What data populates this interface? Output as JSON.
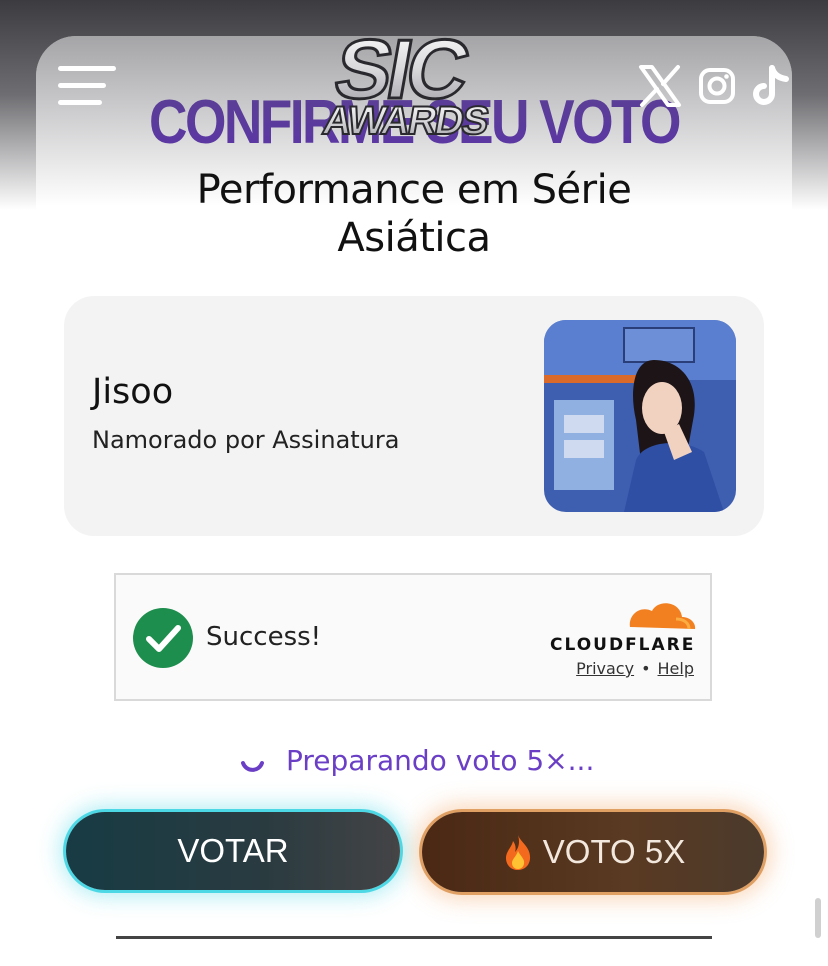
{
  "header": {
    "logo_text": "SIC AWARDS",
    "confirm_heading": "CONFIRME SEU VOTO",
    "menu_icon": "hamburger-menu-icon",
    "social": [
      "x-icon",
      "instagram-icon",
      "tiktok-icon"
    ]
  },
  "category": {
    "title": "Performance em Série Asiática"
  },
  "nominee": {
    "name": "Jisoo",
    "show": "Namorado por Assinatura"
  },
  "captcha": {
    "status": "Success!",
    "provider": "CLOUDFLARE",
    "privacy_link": "Privacy",
    "separator": "•",
    "help_link": "Help"
  },
  "status": {
    "message": "Preparando voto 5×..."
  },
  "actions": {
    "vote_label": "VOTAR",
    "vote5_label": "VOTO 5X"
  },
  "colors": {
    "accent_purple": "#5b2fb3",
    "success_green": "#1e8e4e",
    "cloudflare_orange": "#f38020",
    "vote_glow": "#4dd8e6",
    "vote5_glow": "#e0a063"
  }
}
